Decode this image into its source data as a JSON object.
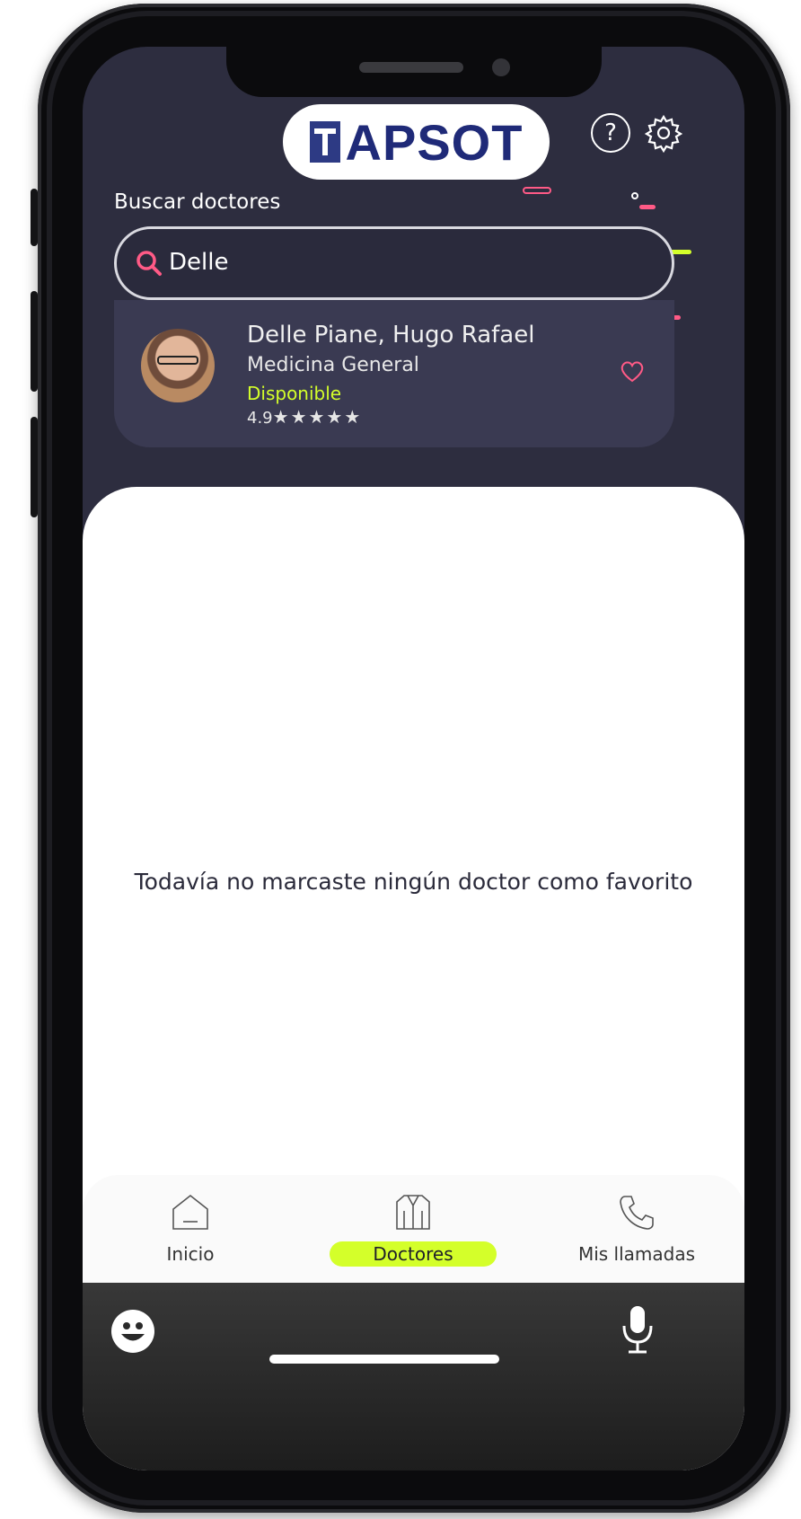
{
  "app": {
    "logo_text": "APSOT"
  },
  "header": {
    "help_icon": "question-icon",
    "settings_icon": "gear-icon"
  },
  "search": {
    "label": "Buscar doctores",
    "value": "Delle",
    "icon": "search-icon"
  },
  "results": [
    {
      "name": "Delle Piane, Hugo Rafael",
      "specialty": "Medicina General",
      "status": "Disponible",
      "rating": "4.9",
      "stars": "★★★★★",
      "rating_value": 5,
      "favorite": false
    }
  ],
  "favorites": {
    "empty_message": "Todavía no marcaste ningún doctor como favorito"
  },
  "nav": {
    "items": [
      {
        "label": "Inicio",
        "icon": "home-icon",
        "active": false
      },
      {
        "label": "Doctores",
        "icon": "doctor-coat-icon",
        "active": true
      },
      {
        "label": "Mis llamadas",
        "icon": "phone-icon",
        "active": false
      }
    ]
  },
  "keyboard": {
    "left_icon": "emoji-icon",
    "right_icon": "microphone-icon"
  },
  "colors": {
    "accent": "#d4ff2a",
    "pink": "#ff5a86",
    "background": "#2d2d3f",
    "card": "#3a3a52"
  }
}
